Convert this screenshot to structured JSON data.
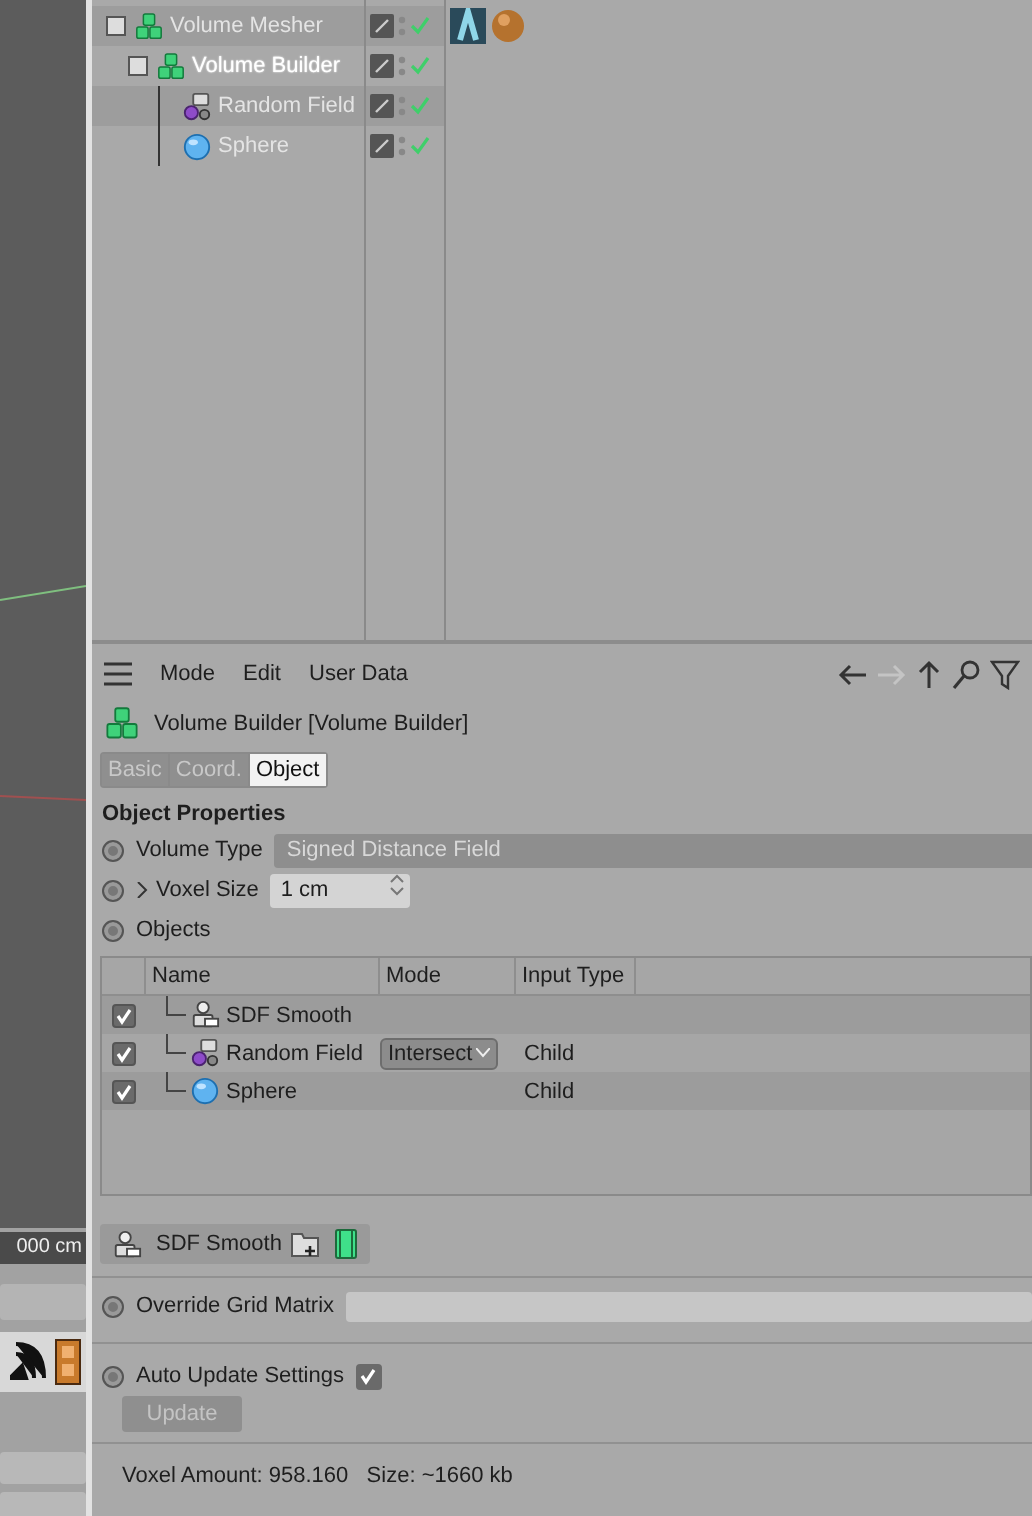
{
  "objects": [
    {
      "name": "Volume Mesher",
      "kind": "volume",
      "selected": false,
      "materials": true,
      "expanded": true,
      "children": [
        {
          "name": "Volume Builder",
          "kind": "volume",
          "selected": true,
          "materials": false,
          "expanded": true,
          "children": [
            {
              "name": "Random Field",
              "kind": "field",
              "selected": false,
              "materials": false
            },
            {
              "name": "Sphere",
              "kind": "sphere",
              "selected": false,
              "materials": false
            }
          ]
        }
      ]
    }
  ],
  "attributes": {
    "menu": [
      "Mode",
      "Edit",
      "User Data"
    ],
    "title": "Volume Builder [Volume Builder]",
    "tabs": [
      {
        "label": "Basic",
        "selected": false
      },
      {
        "label": "Coord.",
        "selected": false
      },
      {
        "label": "Object",
        "selected": true
      }
    ],
    "section": "Object Properties",
    "volume_type": {
      "label": "Volume Type",
      "value": "Signed Distance Field",
      "keyframe": false
    },
    "voxel_size": {
      "label": "Voxel Size",
      "value": "1 cm",
      "keyframe": false,
      "expanded": false
    },
    "objects_field": {
      "label": "Objects",
      "keyframe": false
    },
    "table": {
      "columns": [
        "Name",
        "Mode",
        "Input Type"
      ],
      "rows": [
        {
          "name": "SDF Smooth",
          "kind": "smooth",
          "checked": true,
          "mode": "",
          "input_type": ""
        },
        {
          "name": "Random Field",
          "kind": "field",
          "checked": true,
          "mode": "Intersect",
          "input_type": "Child"
        },
        {
          "name": "Sphere",
          "kind": "sphere",
          "checked": true,
          "mode": "",
          "input_type": "Child"
        }
      ]
    },
    "selected_item": "SDF Smooth",
    "override": {
      "label": "Override Grid Matrix",
      "keyframe": false
    },
    "auto_update": {
      "label": "Auto Update Settings",
      "checked": true,
      "keyframe": false
    },
    "update_button": {
      "label": "Update",
      "disabled": true
    },
    "info": "Voxel Amount: 958.160   Size: ~1660 kb"
  },
  "left": {
    "field": "000 cm"
  }
}
